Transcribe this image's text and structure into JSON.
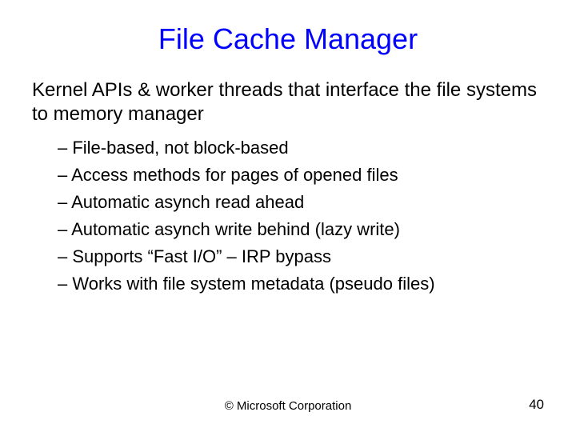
{
  "title": "File Cache Manager",
  "intro": "Kernel APIs & worker threads that interface the file systems to memory manager",
  "bullets": [
    "– File-based, not block-based",
    "– Access methods for pages of opened files",
    "– Automatic asynch read ahead",
    "– Automatic asynch write behind (lazy write)",
    "– Supports “Fast I/O” – IRP bypass",
    "– Works with file system metadata (pseudo files)"
  ],
  "copyright": "© Microsoft Corporation",
  "page_number": "40"
}
